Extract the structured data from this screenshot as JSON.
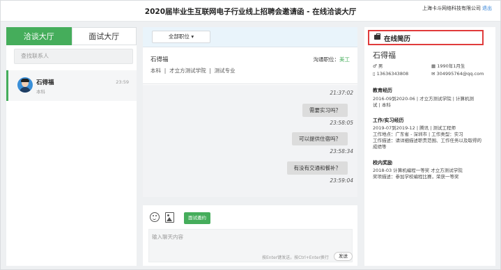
{
  "header": {
    "title": "2020届毕业生互联网电子行业线上招聘会邀请函 - 在线洽谈大厅",
    "company": "上海卡斗网络科技有限公司",
    "logout": "退出"
  },
  "left": {
    "tabs": [
      {
        "label": "洽谈大厅",
        "active": true
      },
      {
        "label": "面试大厅",
        "active": false
      }
    ],
    "search_placeholder": "查找联系人",
    "contacts": [
      {
        "name": "石得福",
        "sub": "本科",
        "time": "23:59"
      }
    ]
  },
  "chat": {
    "position_dropdown": "全部职位",
    "candidate_name": "石得福",
    "position_label": "沟通职位：",
    "position_value": "美工",
    "detail": "本科  |  才立方测试学院  |  测试专业",
    "messages": [
      {
        "time": "21:37:02",
        "text": "需要实习吗？",
        "sent_time": "23:58:05"
      },
      {
        "text": "可以提供住宿吗？",
        "sent_time": "23:58:34"
      },
      {
        "text": "有没有交通和餐补？",
        "sent_time": "23:59:04"
      }
    ],
    "invite_button": "面试邀约",
    "input_placeholder": "输入聊天内容",
    "hint": "按Enter键发送，按Ctrl+Enter换行",
    "send_button": "发送"
  },
  "resume": {
    "title": "在线简历",
    "name": "石得福",
    "gender": "男",
    "birth": "1990年1月生",
    "phone": "13636343808",
    "email": "304995764@qq.com",
    "education_title": "教育经历",
    "education_line1": "2016-09到2020-06  |  才立方测试学院  |  计算机测",
    "education_line2": "试  |  本科",
    "work_title": "工作/实习经历",
    "work_line1": "2019-07到2019-12  |  腾讯  |  测试工程师",
    "work_line2": "工作地点：广东省 - 深圳市 | 工作类型：实习",
    "work_line3": "工作描述：请详细描述职责范围、工作任务以及取得的",
    "work_line4": "成绩等",
    "award_title": "校内奖励",
    "award_line1": "2018-03   计算机编程一等奖   才立方测试学院",
    "award_line2": "奖项描述：参加学校编程比赛，荣获一等奖"
  },
  "colors": {
    "accent_green": "#45ad5b",
    "highlight_red": "#e03b3b",
    "chat_header_bg": "#e9f4fb"
  }
}
